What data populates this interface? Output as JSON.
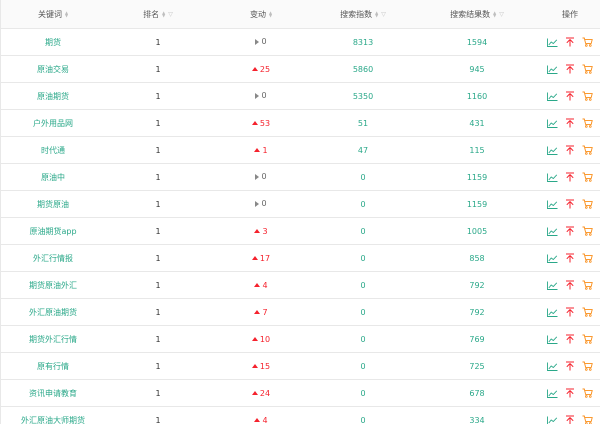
{
  "headers": {
    "keyword": "关键词",
    "rank": "排名",
    "change": "变动",
    "search_index": "搜索指数",
    "search_results": "搜索结果数",
    "actions": "操作"
  },
  "colors": {
    "keyword": "#2aa889",
    "up": "#f5222d",
    "trend_icon": "#2aa889",
    "top_icon": "#f5222d",
    "cart_icon": "#fa8c16"
  },
  "icons": {
    "trend": "line-chart-icon",
    "top": "pin-top-icon",
    "cart": "shopping-cart-icon"
  },
  "rows": [
    {
      "keyword": "期货",
      "rank": "1",
      "direction": "flat",
      "change": "0",
      "search_index": "8313",
      "results": "1594"
    },
    {
      "keyword": "原油交易",
      "rank": "1",
      "direction": "up",
      "change": "25",
      "search_index": "5860",
      "results": "945"
    },
    {
      "keyword": "原油期货",
      "rank": "1",
      "direction": "flat",
      "change": "0",
      "search_index": "5350",
      "results": "1160"
    },
    {
      "keyword": "户外用品网",
      "rank": "1",
      "direction": "up",
      "change": "53",
      "search_index": "51",
      "results": "431"
    },
    {
      "keyword": "时代通",
      "rank": "1",
      "direction": "up",
      "change": "1",
      "search_index": "47",
      "results": "115"
    },
    {
      "keyword": "原油中",
      "rank": "1",
      "direction": "flat",
      "change": "0",
      "search_index": "0",
      "results": "1159"
    },
    {
      "keyword": "期货原油",
      "rank": "1",
      "direction": "flat",
      "change": "0",
      "search_index": "0",
      "results": "1159"
    },
    {
      "keyword": "原油期货app",
      "rank": "1",
      "direction": "up",
      "change": "3",
      "search_index": "0",
      "results": "1005"
    },
    {
      "keyword": "外汇行情报",
      "rank": "1",
      "direction": "up",
      "change": "17",
      "search_index": "0",
      "results": "858"
    },
    {
      "keyword": "期货原油外汇",
      "rank": "1",
      "direction": "up",
      "change": "4",
      "search_index": "0",
      "results": "792"
    },
    {
      "keyword": "外汇原油期货",
      "rank": "1",
      "direction": "up",
      "change": "7",
      "search_index": "0",
      "results": "792"
    },
    {
      "keyword": "期货外汇行情",
      "rank": "1",
      "direction": "up",
      "change": "10",
      "search_index": "0",
      "results": "769"
    },
    {
      "keyword": "原有行情",
      "rank": "1",
      "direction": "up",
      "change": "15",
      "search_index": "0",
      "results": "725"
    },
    {
      "keyword": "资讯申请教育",
      "rank": "1",
      "direction": "up",
      "change": "24",
      "search_index": "0",
      "results": "678"
    },
    {
      "keyword": "外汇原油大师期货",
      "rank": "1",
      "direction": "up",
      "change": "4",
      "search_index": "0",
      "results": "334"
    }
  ]
}
